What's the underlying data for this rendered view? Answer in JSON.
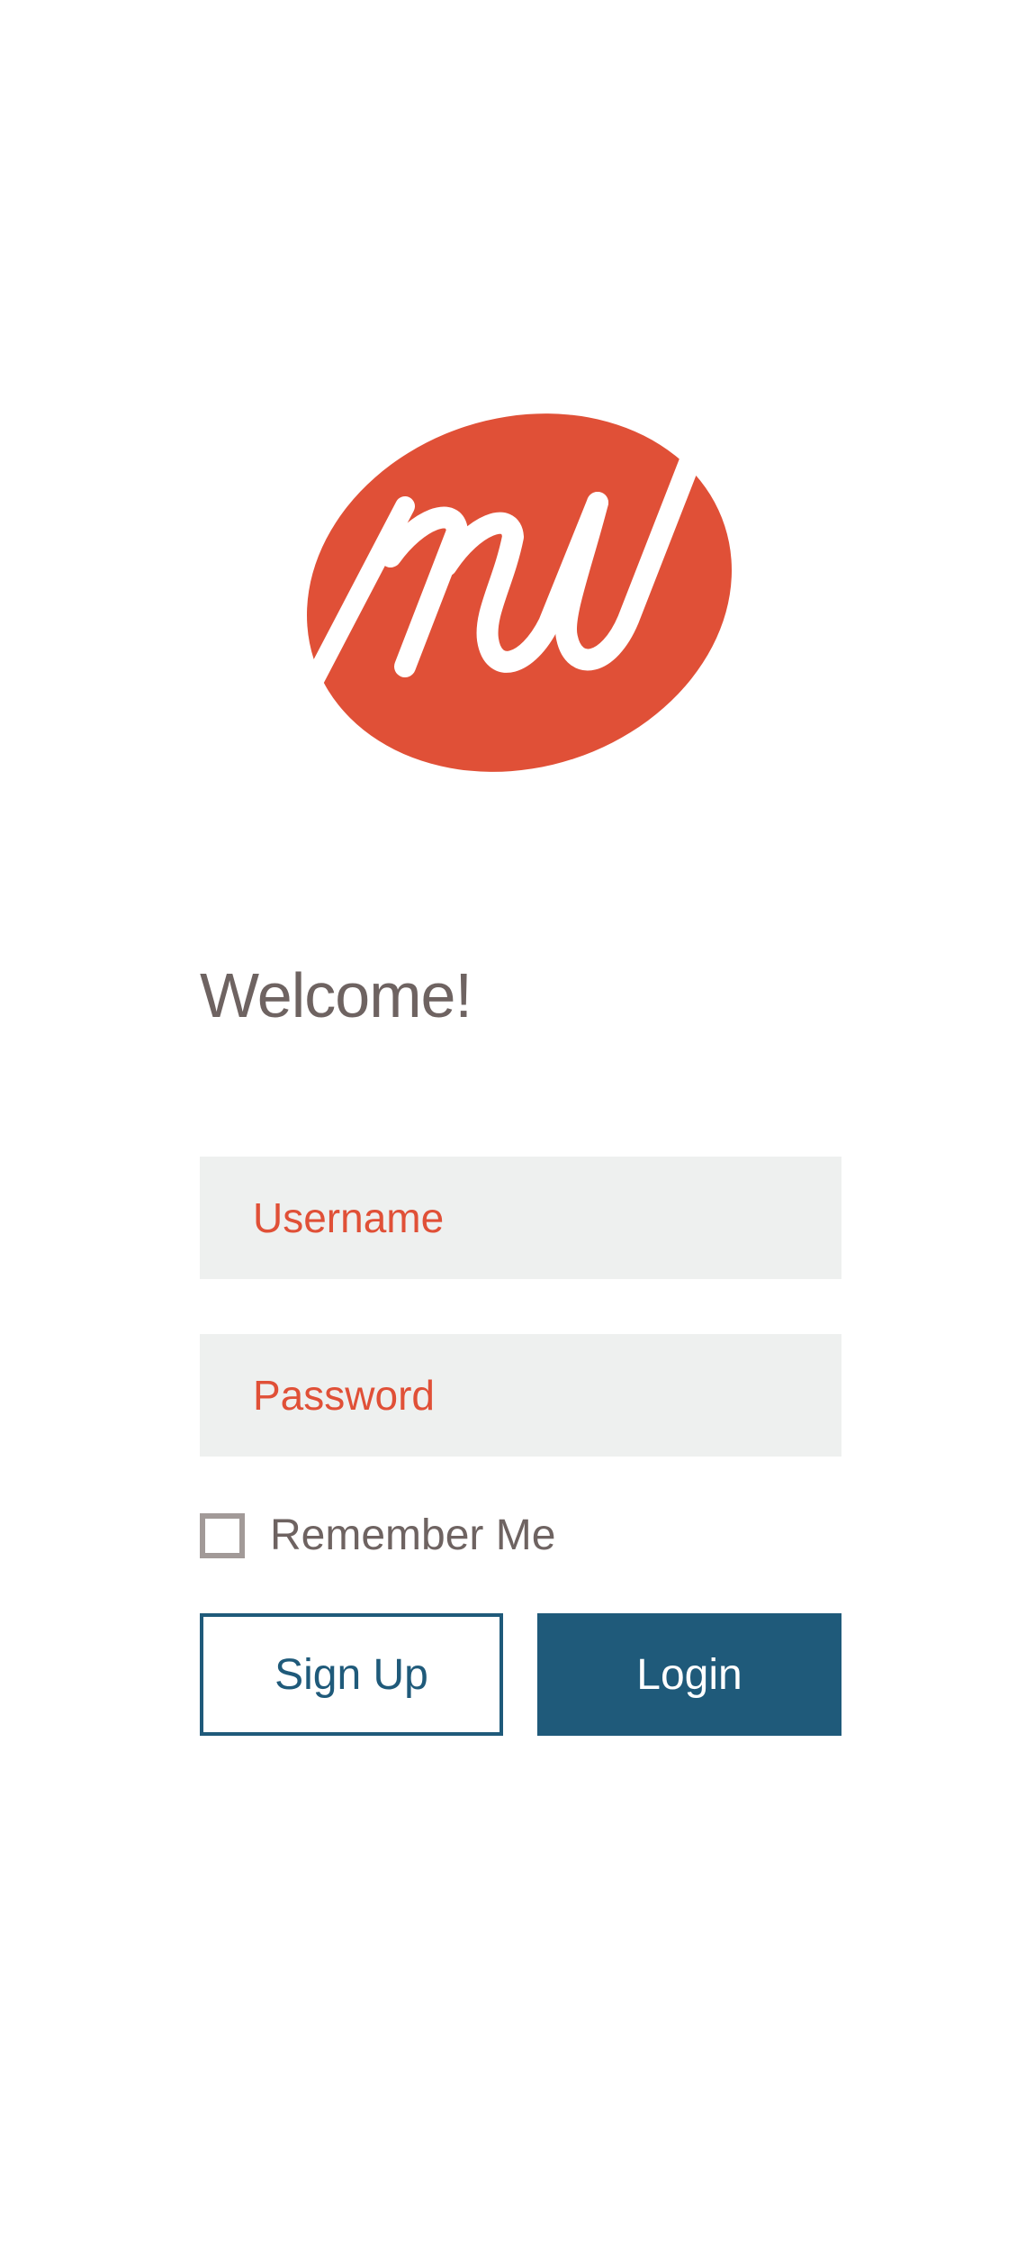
{
  "logo": {
    "icon": "mw-logo",
    "brand_color": "#e05037",
    "initials": "mw"
  },
  "welcome": {
    "title": "Welcome!"
  },
  "form": {
    "username_placeholder": "Username",
    "password_placeholder": "Password",
    "remember_label": "Remember Me",
    "remember_checked": false,
    "signup_label": "Sign Up",
    "login_label": "Login"
  },
  "colors": {
    "accent": "#e05037",
    "primary": "#1f5a7a",
    "text": "#6e6361",
    "field_bg": "#eef0ef"
  }
}
